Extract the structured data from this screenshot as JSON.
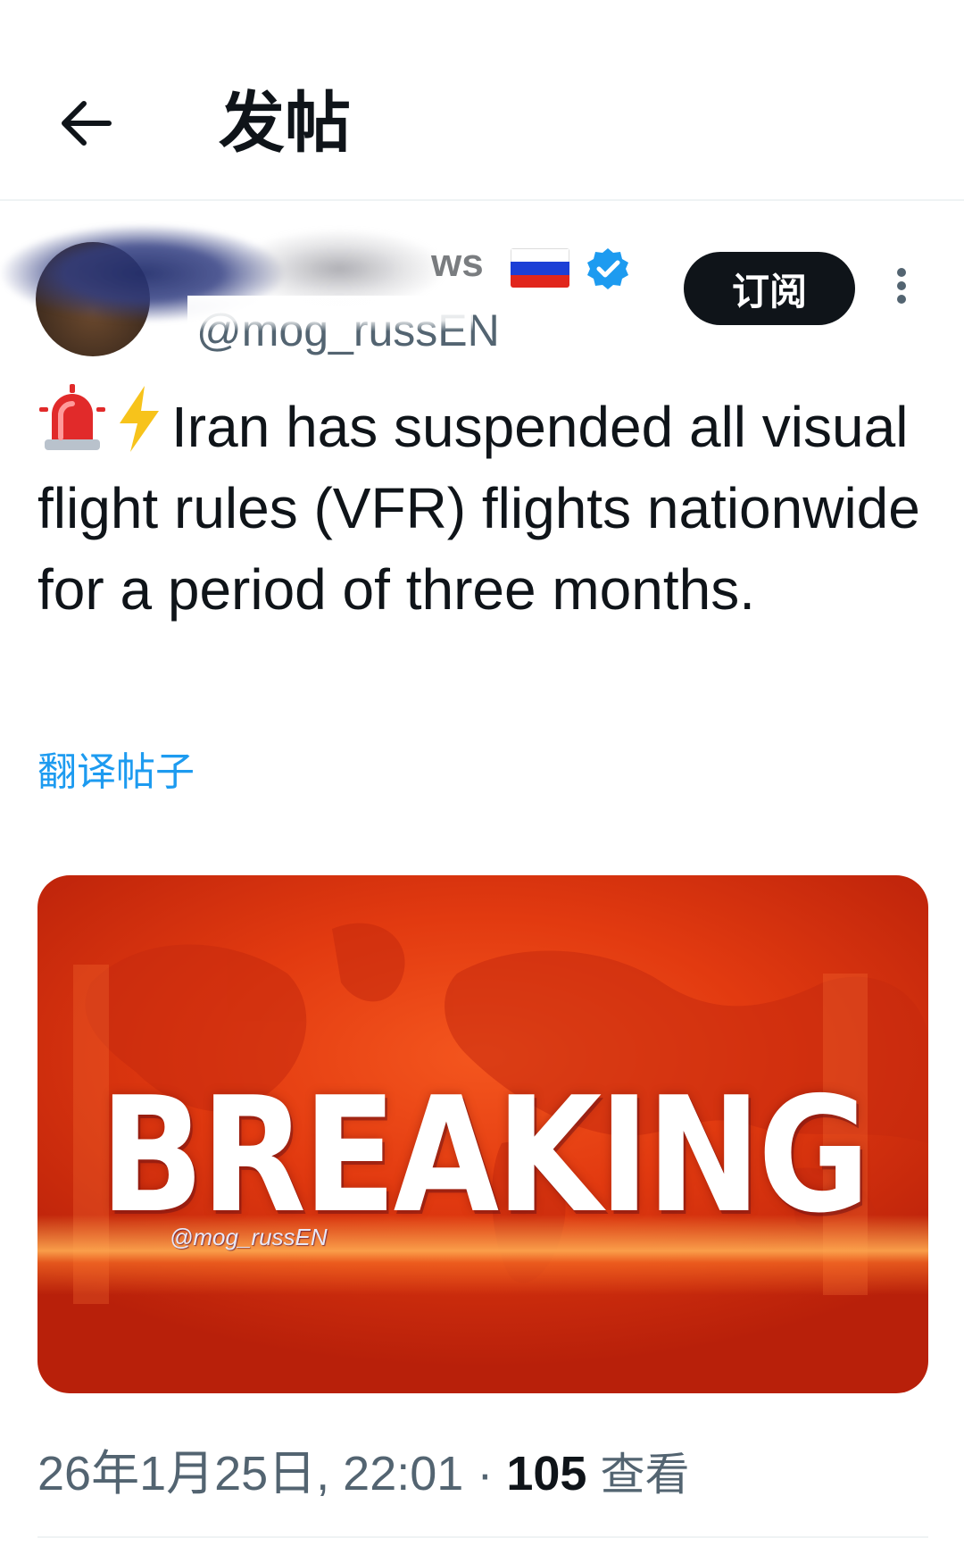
{
  "header": {
    "title": "发帖"
  },
  "author": {
    "name_suffix": "ws",
    "handle": "@mog_russEN",
    "subscribe_label": "订阅"
  },
  "tweet": {
    "text": "Iran has suspended all visual flight rules (VFR) flights nationwide for a period of three months.",
    "translate_label": "翻译帖子"
  },
  "media": {
    "headline": "BREAKING",
    "watermark": "@mog_russEN"
  },
  "meta": {
    "timestamp": "26年1月25日, 22:01",
    "separator": "·",
    "views_count": "105",
    "views_label": "查看"
  },
  "colors": {
    "accent": "#1d9bf0",
    "text_primary": "#0f1419",
    "text_secondary": "#536471",
    "button_bg": "#0f1419",
    "flag_white": "#ffffff",
    "flag_blue": "#1c3fd6",
    "flag_red": "#e1261c"
  },
  "icons": {
    "back": "arrow-left-icon",
    "verified": "verified-badge-icon",
    "more": "more-vertical-icon",
    "emoji_1": "police-light-icon",
    "emoji_2": "lightning-icon"
  }
}
